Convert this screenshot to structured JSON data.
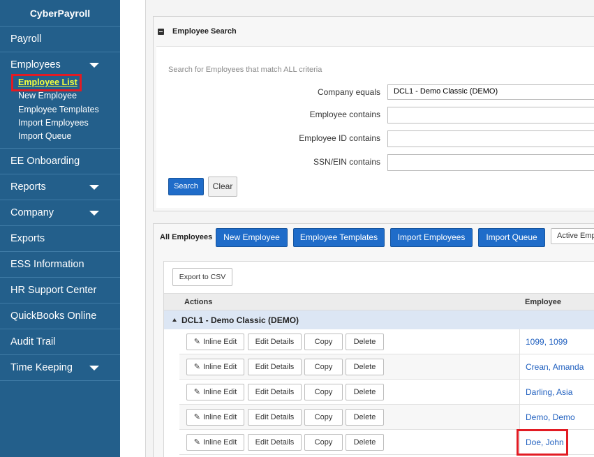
{
  "sidebar": {
    "brand": "CyberPayroll",
    "payroll": "Payroll",
    "employees": "Employees",
    "employee_sub": [
      "Employee List",
      "New Employee",
      "Employee Templates",
      "Import Employees",
      "Import Queue"
    ],
    "items_after": [
      "EE Onboarding",
      "Reports",
      "Company",
      "Exports",
      "ESS Information",
      "HR Support Center",
      "QuickBooks Online",
      "Audit Trail",
      "Time Keeping"
    ]
  },
  "search": {
    "title": "Employee Search",
    "hint": "Search for Employees that match ALL criteria",
    "company_label": "Company equals",
    "company_value": "DCL1 - Demo Classic (DEMO)",
    "employee_label": "Employee contains",
    "employee_id_label": "Employee ID contains",
    "ssn_label": "SSN/EIN contains",
    "search_button": "Search",
    "clear_button": "Clear"
  },
  "list": {
    "all_label": "All Employees",
    "buttons": [
      "New Employee",
      "Employee Templates",
      "Import Employees",
      "Import Queue"
    ],
    "filter": "Active Emp",
    "export": "Export to CSV",
    "col_actions": "Actions",
    "col_employee": "Employee",
    "group": "DCL1 - Demo Classic (DEMO)",
    "row_actions": [
      "Inline Edit",
      "Edit Details",
      "Copy",
      "Delete"
    ],
    "employees": [
      "1099, 1099",
      "Crean, Amanda",
      "Darling, Asia",
      "Demo, Demo",
      "Doe, John"
    ]
  },
  "colors": {
    "sidebar": "#235f8b",
    "primary_button": "#1f6cc9",
    "highlight": "#e21b23",
    "link": "#1f5fbf"
  }
}
